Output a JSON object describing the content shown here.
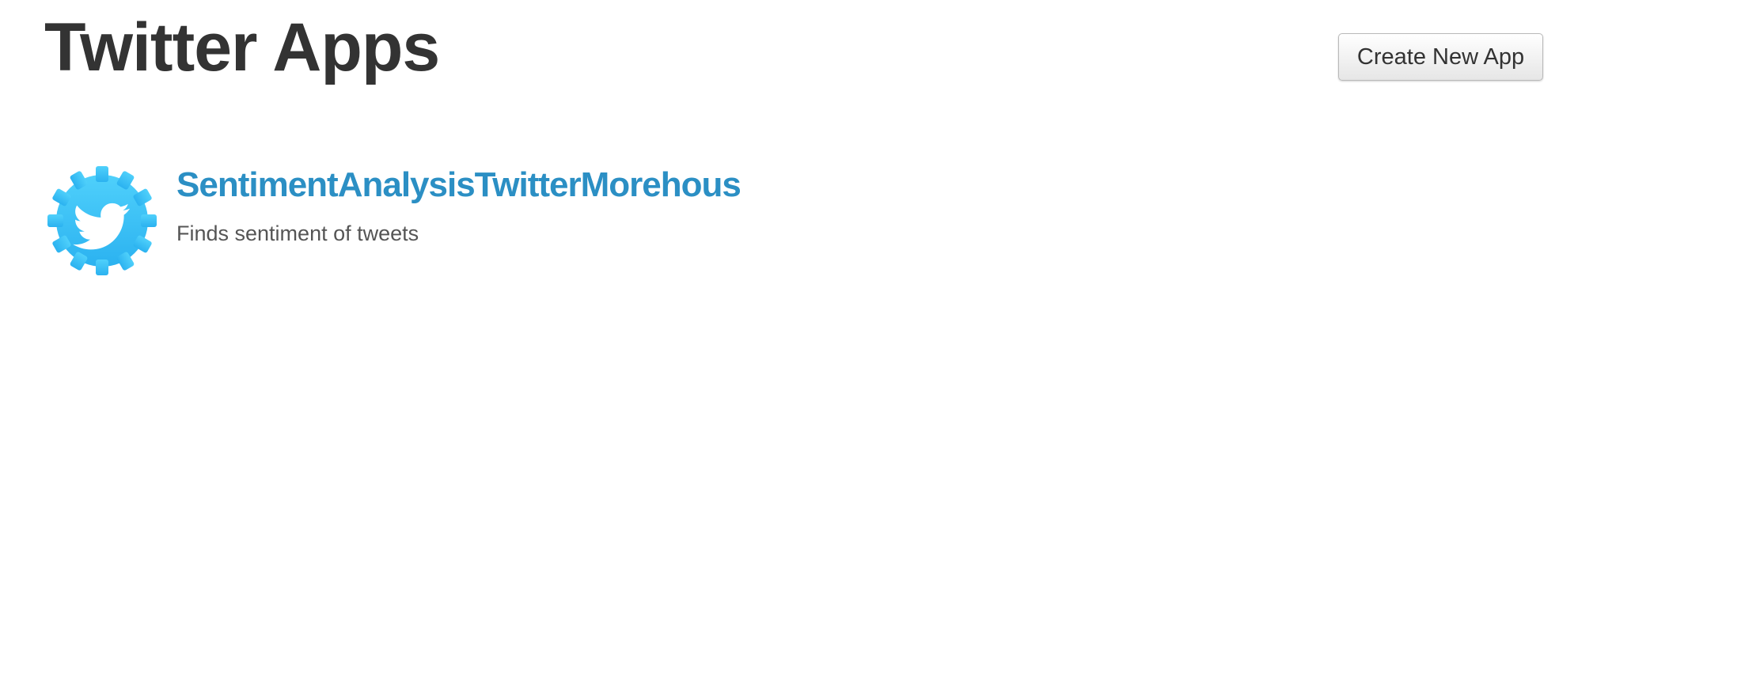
{
  "header": {
    "title": "Twitter Apps",
    "create_button_label": "Create New App"
  },
  "apps": [
    {
      "name": "SentimentAnalysisTwitterMorehous",
      "description": "Finds sentiment of tweets",
      "icon": "twitter-gear-icon"
    }
  ],
  "colors": {
    "link": "#2b8fc4",
    "icon_blue": "#3cc3f5",
    "title": "#333333"
  }
}
